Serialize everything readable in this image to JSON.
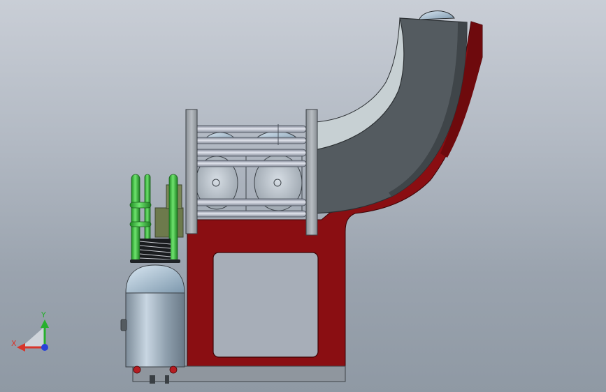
{
  "triad": {
    "x_label": "X",
    "y_label": "Y",
    "x_color": "#d8342a",
    "y_color": "#27b02d",
    "z_color": "#2a43d8"
  },
  "colors": {
    "frame_red": "#8a0e12",
    "frame_red_dark": "#5e0709",
    "housing_gray": "#545b60",
    "housing_light": "#c7d0d3",
    "plate_gray": "#9da3a8",
    "tube_green": "#37c23a",
    "tank_blue": "#9fb8cc"
  }
}
